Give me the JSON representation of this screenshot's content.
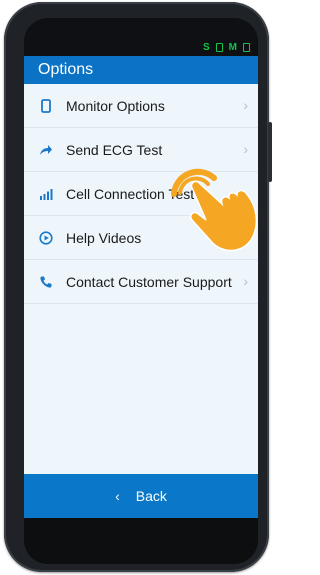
{
  "status": {
    "s_label": "S",
    "m_label": "M"
  },
  "header": {
    "title": "Options"
  },
  "menu": [
    {
      "label": "Monitor Options",
      "icon": "phone-icon"
    },
    {
      "label": "Send ECG Test",
      "icon": "send-arrow-icon"
    },
    {
      "label": "Cell Connection Test",
      "icon": "signal-bars-icon"
    },
    {
      "label": "Help Videos",
      "icon": "play-circle-icon"
    },
    {
      "label": "Contact Customer Support",
      "icon": "telephone-icon"
    }
  ],
  "chevron": "›",
  "footer": {
    "back_arrow": "‹",
    "back_label": "Back"
  },
  "colors": {
    "accent": "#0a73c6",
    "content_bg": "#eef6fb",
    "status_green": "#17c24c",
    "hand": "#f5a623"
  }
}
